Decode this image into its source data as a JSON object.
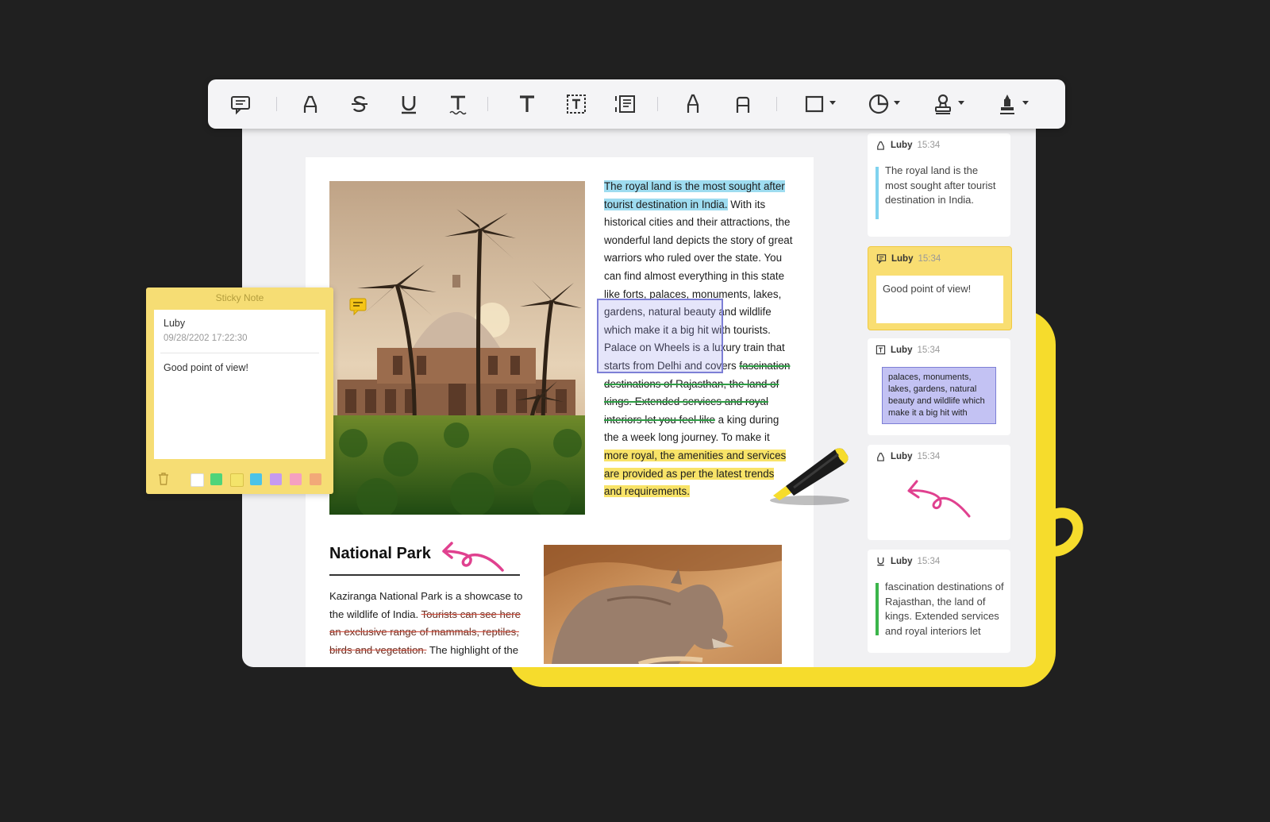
{
  "toolbar": {
    "tools": [
      {
        "name": "comment-icon"
      },
      {
        "name": "highlight-icon"
      },
      {
        "name": "strikethrough-icon"
      },
      {
        "name": "underline-icon"
      },
      {
        "name": "squiggly-icon"
      },
      {
        "name": "text-icon"
      },
      {
        "name": "textbox-icon"
      },
      {
        "name": "text-callout-icon"
      },
      {
        "name": "pencil-icon"
      },
      {
        "name": "eraser-icon"
      },
      {
        "name": "shape-icon"
      },
      {
        "name": "sticker-icon"
      },
      {
        "name": "stamp-icon"
      },
      {
        "name": "signature-icon"
      }
    ]
  },
  "sticky_note": {
    "header": "Sticky Note",
    "author": "Luby",
    "date": "09/28/2202 17:22:30",
    "content": "Good point of view!",
    "colors": [
      "#ffffff",
      "#4fd47a",
      "#f4e46a",
      "#4cc3e8",
      "#c69af0",
      "#f5a0c0",
      "#f2a978"
    ]
  },
  "document": {
    "paragraph1": {
      "highlight_blue": "The royal land is the most sought after tourist destination in India.",
      "part2": " With its historical cities and their attractions, the wonderful land depicts the story of great warriors who ruled over the state. You can find almost everything in this state like ",
      "selected": "forts, palaces, monuments, lakes, gardens, natural beauty and wildlife which make it a big hit with tourists. Palace on Wheels is a luxury train",
      "part3": " that starts from Delhi and covers ",
      "strike_green": "fascination destinations of Rajasthan, the land of kings. Extended services and royal interiors let you feel like",
      "part4": " a king during the a week long journey. To make it ",
      "highlight_yellow": "more royal, the amenities and services are provided as per the latest trends and requirements."
    },
    "section_title": "National Park",
    "paragraph2": {
      "part1": "Kaziranga National Park is a showcase to the wildlife of India. ",
      "strike_red": "Tourists can see here an exclusive range of mammals, reptiles, birds and vegetation.",
      "part2": " The highlight of the"
    }
  },
  "sidebar": {
    "cards": [
      {
        "author": "Luby",
        "time": "15:34",
        "text": "The royal land is the most sought after tourist destination in India.",
        "bar_color": "#7fd3ef"
      },
      {
        "author": "Luby",
        "time": "15:34",
        "text": "Good point of view!"
      },
      {
        "author": "Luby",
        "time": "15:34",
        "text": "palaces, monuments, lakes, gardens, natural beauty and wildlife which make it a big hit with"
      },
      {
        "author": "Luby",
        "time": "15:34"
      },
      {
        "author": "Luby",
        "time": "15:34",
        "text": "fascination destinations of Rajasthan, the land of kings. Extended services and royal interiors let",
        "bar_color": "#3bb54a"
      }
    ]
  },
  "colors": {
    "accent_yellow": "#f6dc2c",
    "ink_pink": "#e0418f",
    "selection_purple": "#7d7fd6"
  }
}
